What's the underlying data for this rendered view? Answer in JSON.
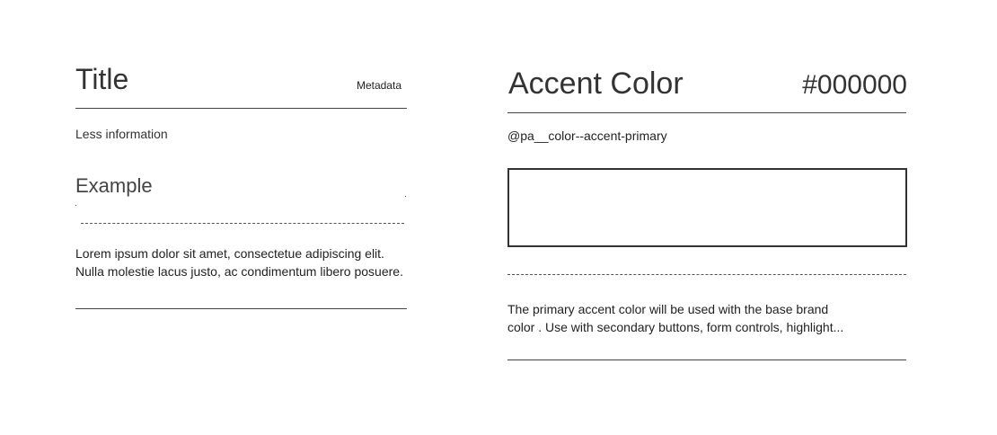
{
  "left_card": {
    "title": "Title",
    "metadata": "Metadata",
    "subtitle": "Less information",
    "example_label": "Example",
    "body_lines": [
      "Lorem ipsum dolor sit amet, consectetue adipiscing elit.",
      "Nulla molestie lacus justo, ac condimentum libero posuere."
    ]
  },
  "right_card": {
    "title": "Accent Color",
    "hex_value": "#000000",
    "token": "@pa__color--accent-primary",
    "swatch_color": "#ffffff",
    "description_lines": [
      "The primary accent color will be used with the base brand",
      "color . Use with secondary buttons, form controls,  highlight..."
    ]
  }
}
